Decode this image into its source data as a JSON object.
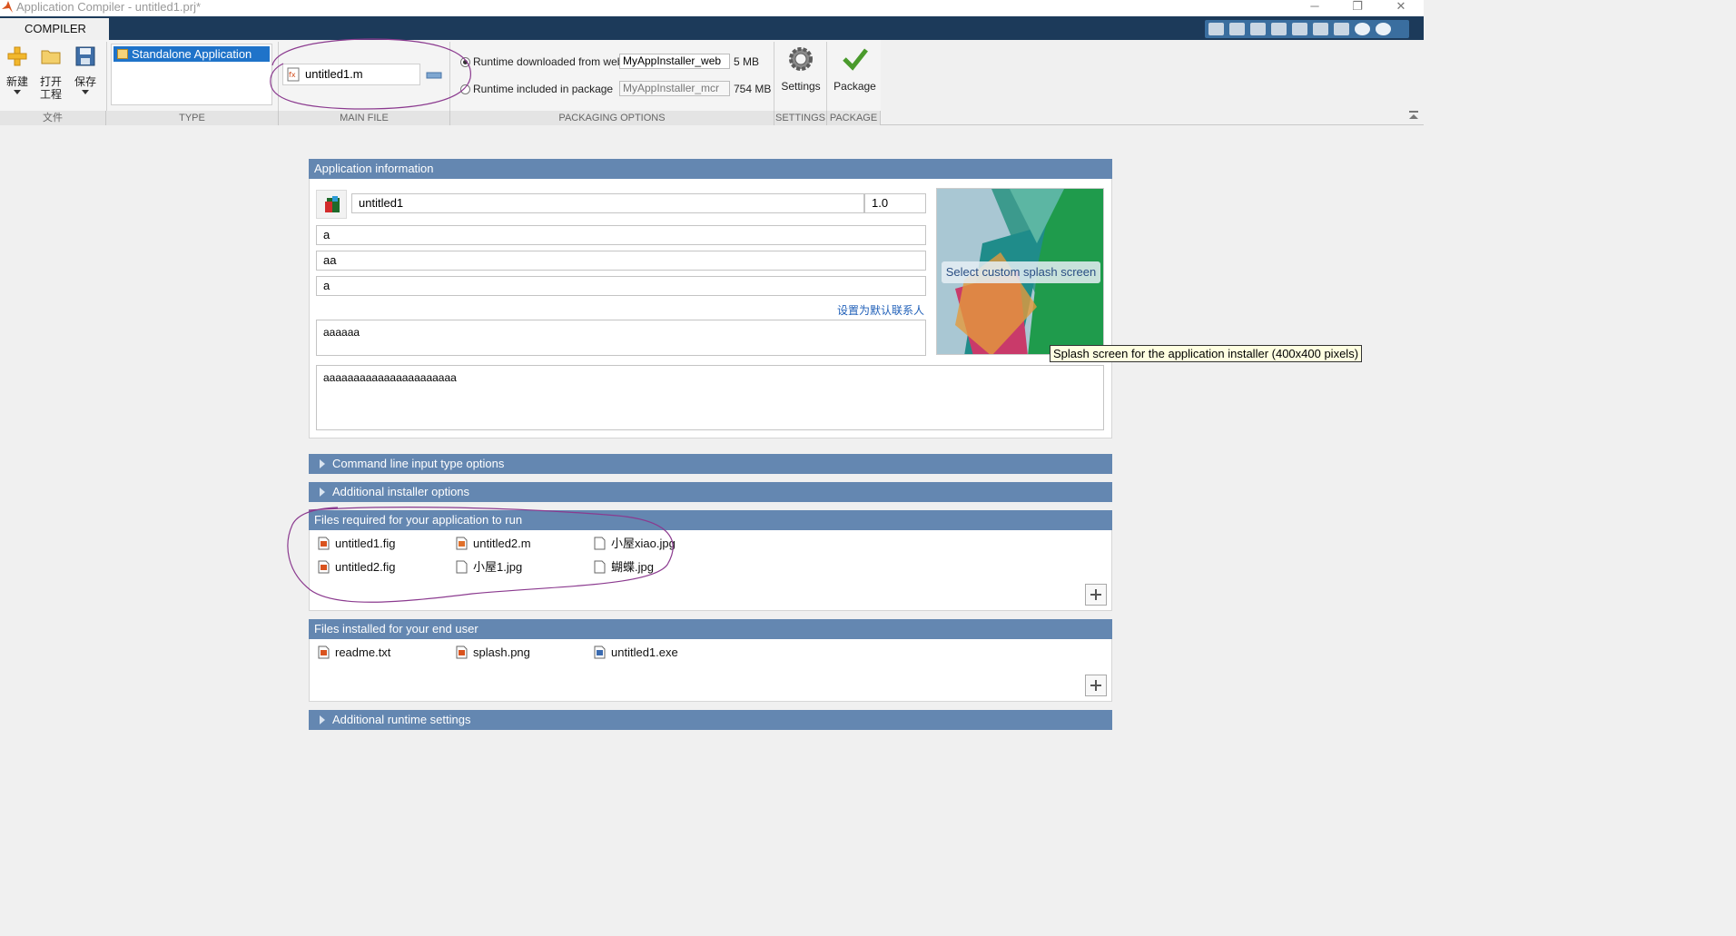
{
  "window": {
    "title": "Application Compiler - untitled1.prj*",
    "minimize": "─",
    "restore": "❐",
    "close": "✕"
  },
  "ribbon": {
    "tab_label": "COMPILER",
    "file_section": {
      "label": "文件",
      "new_label": "新建",
      "open_label_line1": "打开",
      "open_label_line2": "工程",
      "save_label": "保存"
    },
    "type_section": {
      "label": "TYPE",
      "selected_type": "Standalone Application"
    },
    "main_file_section": {
      "label": "MAIN FILE",
      "file": "untitled1.m"
    },
    "packaging_section": {
      "label": "PACKAGING OPTIONS",
      "runtime_web_label": "Runtime downloaded from web",
      "runtime_web_value": "MyAppInstaller_web",
      "runtime_web_size": "5 MB",
      "runtime_pkg_label": "Runtime included in package",
      "runtime_pkg_value": "MyAppInstaller_mcr",
      "runtime_pkg_size": "754 MB"
    },
    "settings_section": {
      "label": "SETTINGS",
      "button_label": "Settings"
    },
    "package_section": {
      "label": "PACKAGE",
      "button_label": "Package"
    }
  },
  "app_info": {
    "header": "Application information",
    "name": "untitled1",
    "version": "1.0",
    "author": "a",
    "email": "aa",
    "company": "a",
    "set_default_contact": "设置为默认联系人",
    "summary": "aaaaaa",
    "description": "aaaaaaaaaaaaaaaaaaaaaa",
    "splash_button": "Select custom splash screen",
    "splash_tooltip": "Splash screen for the application installer (400x400 pixels)"
  },
  "sections": {
    "command_line": "Command line input type options",
    "additional_installer": "Additional installer options",
    "files_required": "Files required for your application to run",
    "files_installed": "Files installed for your end user",
    "additional_runtime": "Additional runtime settings"
  },
  "files_required": [
    {
      "name": "untitled1.fig",
      "icon": "fig-file-icon"
    },
    {
      "name": "untitled2.m",
      "icon": "m-file-icon"
    },
    {
      "name": "小屋xiao.jpg",
      "icon": "generic-file-icon"
    },
    {
      "name": "untitled2.fig",
      "icon": "fig-file-icon"
    },
    {
      "name": "小屋1.jpg",
      "icon": "generic-file-icon"
    },
    {
      "name": "蝴蝶.jpg",
      "icon": "generic-file-icon"
    }
  ],
  "files_installed": [
    {
      "name": "readme.txt",
      "icon": "text-file-icon"
    },
    {
      "name": "splash.png",
      "icon": "image-file-icon"
    },
    {
      "name": "untitled1.exe",
      "icon": "exe-file-icon"
    }
  ],
  "colors": {
    "panel_header": "#6487b1",
    "ribbon_bar": "#1c3a5a",
    "selection": "#1f73c9",
    "annotation": "#8b3a8f"
  }
}
